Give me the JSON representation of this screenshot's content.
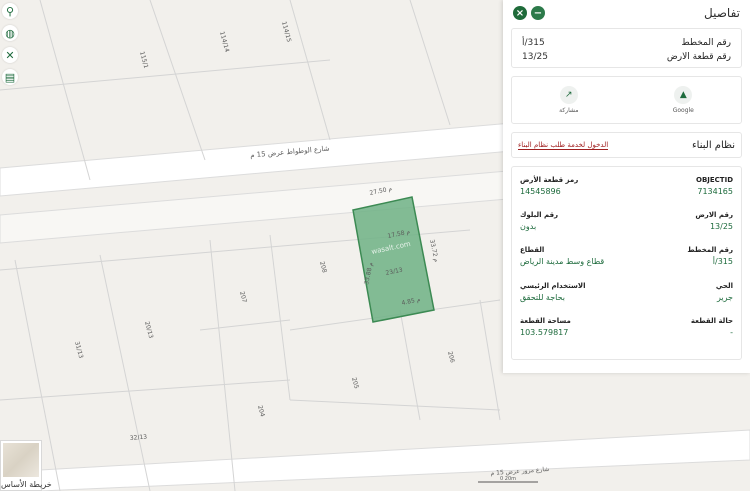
{
  "map": {
    "street_label": "شارع الوطواط عرض 15 م",
    "street_label_bottom": "شارع مرور عرض 15 م",
    "scale_label": "0 20m",
    "plots": [
      {
        "label": "115/1"
      },
      {
        "label": "114/14"
      },
      {
        "label": "114/15"
      },
      {
        "label": "208"
      },
      {
        "label": "207"
      },
      {
        "label": "20/13"
      },
      {
        "label": "31/13"
      },
      {
        "label": "205"
      },
      {
        "label": "206"
      },
      {
        "label": "204"
      },
      {
        "label": "32/13"
      }
    ],
    "highlighted_plot": {
      "labels": [
        "23/13",
        "17.58 م",
        "27.50 م",
        "4.85 م",
        "33.72 م",
        "33.88 م"
      ],
      "dimension_top": "27.50 م",
      "dimension_right": "33.72 م",
      "dimension_bottom": "4.85 م",
      "dimension_left": "33.88 م",
      "area_text": "17.58 م",
      "plot_no": "23/13",
      "watermark": "wasalt.com",
      "fill_color": "#5fae78",
      "stroke_color": "#3c8a53"
    }
  },
  "left_toolbar": {
    "icons": [
      "pin-icon",
      "globe-icon",
      "tools-icon",
      "book-icon"
    ],
    "glyphs": [
      "⚲",
      "◍",
      "✕",
      "▤"
    ]
  },
  "basemap_switch": {
    "label": "خريطة الأساس"
  },
  "panel": {
    "title": "تفاصيل",
    "close_icon": "close-icon",
    "minimize_icon": "minimize-icon",
    "summary": {
      "plan_no_label": "رقم المخطط",
      "plan_no_value": "315/أ",
      "plot_no_label": "رقم قطعة الارض",
      "plot_no_value": "13/25"
    },
    "actions": [
      {
        "label": "Google",
        "icon": "google-icon",
        "glyph": "▲"
      },
      {
        "label": "مشاركة",
        "icon": "share-icon",
        "glyph": "↗"
      }
    ],
    "building_system": {
      "label": "نظام البناء",
      "link_text": "الدخول لخدمة طلب نظام البناء"
    },
    "details": {
      "objectid_label": "OBJECTID",
      "objectid_value": "7134165",
      "land_code_label": "رمز قطعة الأرض",
      "land_code_value": "14545896",
      "plot_no_label": "رقم الارض",
      "plot_no_value": "13/25",
      "block_no_label": "رقم البلوك",
      "block_no_value": "بدون",
      "plan_no_label": "رقم المخطط",
      "plan_no_value": "315/أ",
      "sector_label": "القطاع",
      "sector_value": "قطاع وسط مدينة الرياض",
      "district_label": "الحي",
      "district_value": "جرير",
      "main_use_label": "الاستخدام الرئيسي",
      "main_use_value": "بحاجة للتحقق",
      "status_label": "حالة القطعة",
      "status_value": "-",
      "area_label": "مساحة القطعة",
      "area_value": "103.579817"
    }
  },
  "colors": {
    "accent": "#1e6b3d",
    "link": "#a02020",
    "map_bg": "#f3f1ee"
  }
}
